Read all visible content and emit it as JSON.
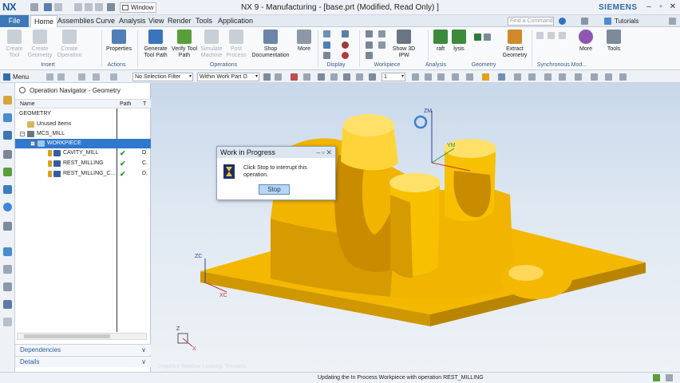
{
  "app": {
    "logo": "NX",
    "title": "NX 9 - Manufacturing - [base.prt (Modified, Read Only) ]",
    "brand": "SIEMENS",
    "window_menu": "Window"
  },
  "menubar": {
    "file": "File",
    "tabs": [
      "Home",
      "Assemblies",
      "Curve",
      "Analysis",
      "View",
      "Render",
      "Tools",
      "Application"
    ],
    "active_tab": "Home",
    "find_placeholder": "Find a Command",
    "tutorials": "Tutorials"
  },
  "ribbon": {
    "insert": {
      "label": "Insert",
      "buttons": [
        "Create Tool",
        "Create Geometry",
        "Create Operation"
      ]
    },
    "actions": {
      "label": "Actions",
      "buttons": [
        "Properties"
      ]
    },
    "operations": {
      "label": "Operations",
      "buttons": [
        "Generate Tool Path",
        "Verify Tool Path",
        "Simulate Machine",
        "Post Process",
        "Shop Documentation",
        "More"
      ]
    },
    "display": {
      "label": "Display"
    },
    "workpiece": {
      "label": "Workpiece",
      "buttons": [
        "Show 3D IPW"
      ]
    },
    "analysis": {
      "label": "Analysis",
      "buttons": [
        "raft",
        "lysis"
      ]
    },
    "geometry": {
      "label": "Geometry",
      "buttons": [
        "Extract Geometry"
      ]
    },
    "sync": {
      "label": "Synchronous Mod...",
      "buttons": [
        "More"
      ]
    },
    "tools": {
      "buttons": [
        "Tools"
      ]
    }
  },
  "selection_bar": {
    "menu": "Menu",
    "filter": "No Selection Filter",
    "scope": "Within Work Part O",
    "count": "1"
  },
  "navigator": {
    "title": "Operation Navigator - Geometry",
    "columns": [
      "Name",
      "Path",
      "T"
    ],
    "rows": [
      {
        "name": "GEOMETRY",
        "path": "",
        "t": ""
      },
      {
        "name": "Unused Items",
        "path": "",
        "t": ""
      },
      {
        "name": "MCS_MILL",
        "path": "",
        "t": ""
      },
      {
        "name": "WORKPIECE",
        "path": "",
        "t": ""
      },
      {
        "name": "CAVITY_MILL",
        "path": "✔",
        "t": "D."
      },
      {
        "name": "REST_MILLING",
        "path": "✔",
        "t": "C."
      },
      {
        "name": "REST_MILLING_C...",
        "path": "✔",
        "t": "D."
      }
    ],
    "panels": [
      "Dependencies",
      "Details"
    ]
  },
  "graphics": {
    "axes": {
      "zm": "ZM",
      "ym": "YM",
      "zc": "ZC",
      "xc": "XC",
      "z": "Z",
      "x": "X"
    },
    "watermark": "Graphics Window Looking: Trimetric",
    "colors": {
      "part": "#f2b600",
      "part_dark": "#c78c00",
      "part_light": "#ffd84a"
    }
  },
  "dialog": {
    "title": "Work in Progress",
    "message": "Click Stop to interrupt this operation.",
    "stop": "Stop"
  },
  "status": {
    "text": "Updating the In Process Workpiece with operation REST_MILLING"
  }
}
